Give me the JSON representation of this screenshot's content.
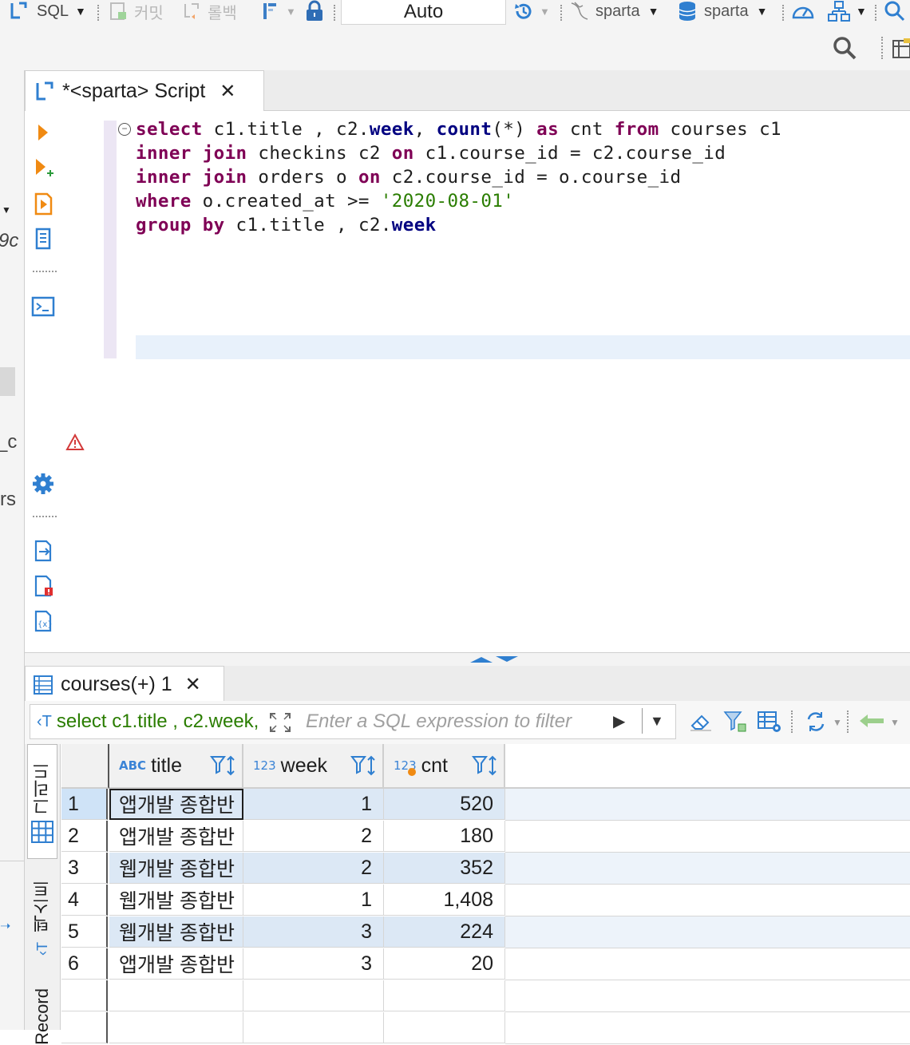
{
  "toolbar": {
    "sql_label": "SQL",
    "commit_label": "커밋",
    "rollback_label": "롤백",
    "transaction_mode": "Auto",
    "connection_label": "sparta",
    "schema_label": "sparta"
  },
  "editor": {
    "tab_title": "*<sparta> Script",
    "code": {
      "l1": {
        "k1": "select",
        "t1": " c1.title , c2.",
        "i1": "week",
        "t2": ", ",
        "i2": "count",
        "t3": "(*) ",
        "k2": "as",
        "t4": " cnt ",
        "k3": "from",
        "t5": " courses c1"
      },
      "l2": {
        "k1": "inner",
        "t1": " ",
        "k2": "join",
        "t2": " checkins c2 ",
        "k3": "on",
        "t3": " c1.course_id = c2.course_id"
      },
      "l3": {
        "k1": "inner",
        "t1": " ",
        "k2": "join",
        "t2": " orders o ",
        "k3": "on",
        "t3": " c2.course_id = o.course_id"
      },
      "l4": {
        "k1": "where",
        "t1": " o.created_at >= ",
        "s1": "'2020-08-01'"
      },
      "l5": {
        "k1": "group",
        "t1": " ",
        "k2": "by",
        "t2": " c1.title , c2.",
        "i1": "week"
      }
    }
  },
  "results": {
    "tab_title": "courses(+) 1",
    "query_snippet": "select c1.title , c2.week, count(*) as cnt from courses c1",
    "filter_placeholder": "Enter a SQL expression to filter",
    "side_tabs": {
      "grid": "그리드",
      "text": "텍스트",
      "record": "Record"
    },
    "columns": [
      {
        "type": "ABC",
        "name": "title"
      },
      {
        "type": "123",
        "name": "week"
      },
      {
        "type": "123",
        "name": "cnt"
      }
    ],
    "rows": [
      {
        "n": "1",
        "title": "앱개발 종합반",
        "week": "1",
        "cnt": "520"
      },
      {
        "n": "2",
        "title": "앱개발 종합반",
        "week": "2",
        "cnt": "180"
      },
      {
        "n": "3",
        "title": "웹개발 종합반",
        "week": "2",
        "cnt": "352"
      },
      {
        "n": "4",
        "title": "웹개발 종합반",
        "week": "1",
        "cnt": "1,408"
      },
      {
        "n": "5",
        "title": "웹개발 종합반",
        "week": "3",
        "cnt": "224"
      },
      {
        "n": "6",
        "title": "앱개발 종합반",
        "week": "3",
        "cnt": "20"
      }
    ]
  },
  "left_panel_fragments": {
    "f1": "9c",
    "f2": "_c",
    "f3": "rs"
  },
  "colors": {
    "accent": "#2f7fd0",
    "keyword": "#7f0055",
    "string": "#2a7d00",
    "stripe": "#dce8f5"
  }
}
